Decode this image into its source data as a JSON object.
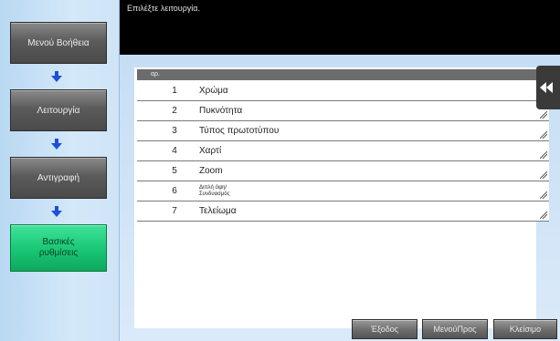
{
  "topbar": {
    "message": "Επιλέξτε λειτουργία."
  },
  "sidebar": {
    "items": [
      {
        "label": "Μενού Βοήθεια"
      },
      {
        "label": "Λειτουργία"
      },
      {
        "label": "Αντιγραφή"
      },
      {
        "label": "Βασικές ρυθμίσεις",
        "line1": "Βασικές",
        "line2": "ρυθμίσεις"
      }
    ]
  },
  "table": {
    "header": "αρ.",
    "rows": [
      {
        "num": "1",
        "label": "Χρώμα"
      },
      {
        "num": "2",
        "label": "Πυκνότητα"
      },
      {
        "num": "3",
        "label": "Τύπος πρωτοτύπου"
      },
      {
        "num": "4",
        "label": "Χαρτί"
      },
      {
        "num": "5",
        "label": "Zoom"
      },
      {
        "num": "6",
        "label_line1": "Διπλή όψη/",
        "label_line2": "Συνδυασμός"
      },
      {
        "num": "7",
        "label": "Τελείωμα"
      }
    ]
  },
  "footer": {
    "exit": "Έξοδος",
    "menu_up": "ΜενούΠρος",
    "close": "Κλείσιμο"
  },
  "colors": {
    "sidebar_bg": "#cfe4f6",
    "active_button": "#18c673",
    "topbar_bg": "#000000"
  }
}
